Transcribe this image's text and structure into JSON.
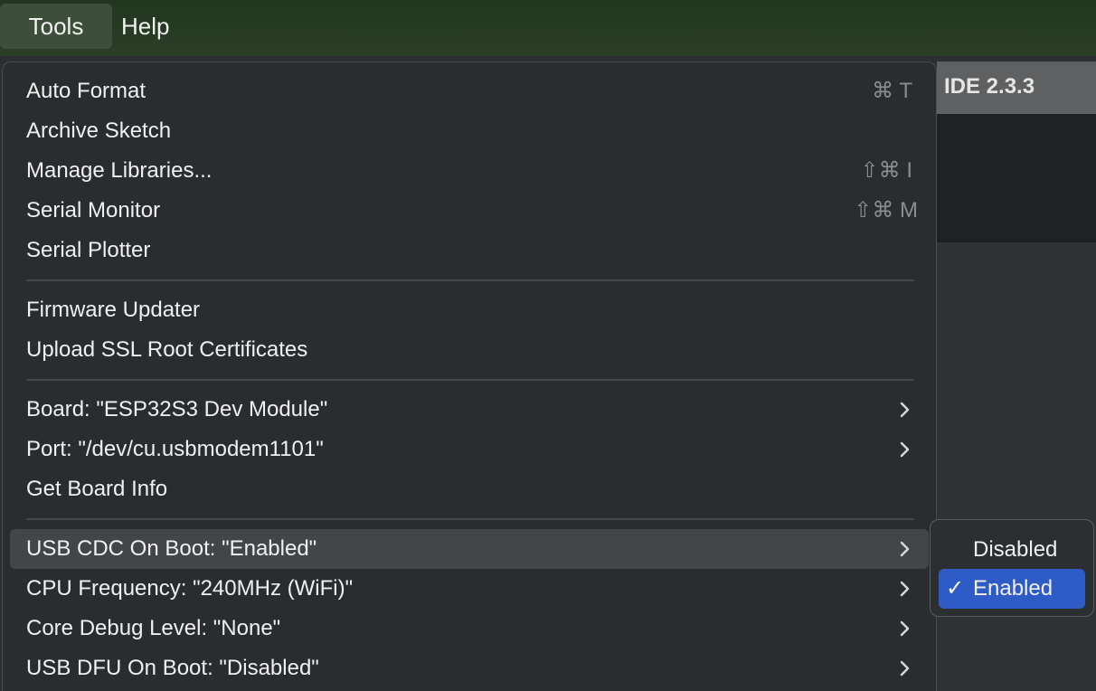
{
  "menubar": {
    "items": [
      {
        "label": "Tools"
      },
      {
        "label": "Help"
      }
    ]
  },
  "app": {
    "title": "IDE 2.3.3"
  },
  "tools_menu": {
    "items": [
      {
        "label": "Auto Format",
        "shortcut": "⌘ T"
      },
      {
        "label": "Archive Sketch",
        "shortcut": ""
      },
      {
        "label": "Manage Libraries...",
        "shortcut": "⇧⌘ I"
      },
      {
        "label": "Serial Monitor",
        "shortcut": "⇧⌘ M"
      },
      {
        "label": "Serial Plotter",
        "shortcut": ""
      },
      {
        "label": "Firmware Updater",
        "shortcut": ""
      },
      {
        "label": "Upload SSL Root Certificates",
        "shortcut": ""
      },
      {
        "label": "Board: \"ESP32S3 Dev Module\"",
        "submenu": true
      },
      {
        "label": "Port: \"/dev/cu.usbmodem1101\"",
        "submenu": true
      },
      {
        "label": "Get Board Info",
        "shortcut": ""
      },
      {
        "label": "USB CDC On Boot: \"Enabled\"",
        "submenu": true,
        "highlighted": true
      },
      {
        "label": "CPU Frequency: \"240MHz (WiFi)\"",
        "submenu": true
      },
      {
        "label": "Core Debug Level: \"None\"",
        "submenu": true
      },
      {
        "label": "USB DFU On Boot: \"Disabled\"",
        "submenu": true
      }
    ]
  },
  "submenu": {
    "items": [
      {
        "label": "Disabled",
        "checked": false
      },
      {
        "label": "Enabled",
        "checked": true,
        "check_mark": "✓"
      }
    ]
  },
  "colors": {
    "menu_bg": "#2a2d2f",
    "highlight": "#434649",
    "selection_blue": "#2e5bc5",
    "menubar_green": "#2a3f26"
  }
}
